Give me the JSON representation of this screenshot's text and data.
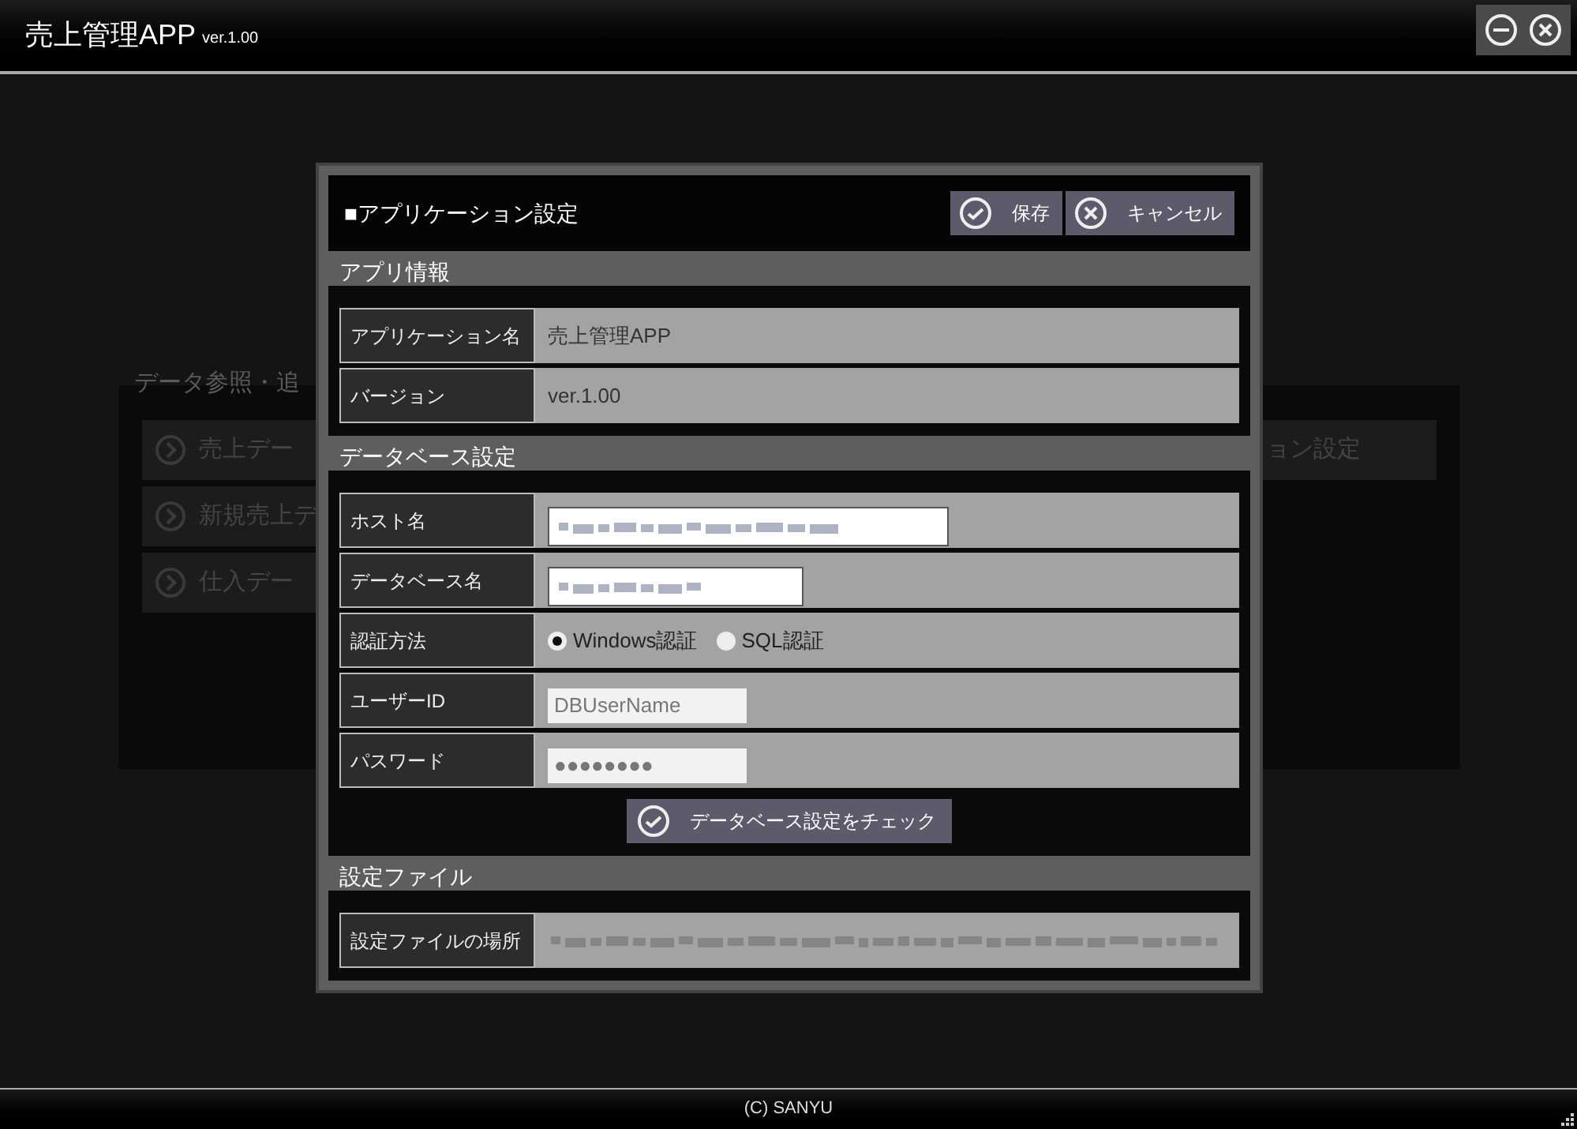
{
  "window": {
    "title": "売上管理APP",
    "version": "ver.1.00"
  },
  "background_menu": {
    "heading": "データ参照・追",
    "items": [
      {
        "label": "売上デー"
      },
      {
        "label": "新規売上デ"
      },
      {
        "label": "仕入デー"
      }
    ],
    "right_item": {
      "label": "ョン設定"
    }
  },
  "dialog": {
    "title": "■アプリケーション設定",
    "buttons": [
      {
        "label": "保存",
        "kind": "save"
      },
      {
        "label": "キャンセル",
        "kind": "cancel"
      }
    ],
    "sections": [
      {
        "title": "アプリ情報",
        "rows": [
          {
            "label": "アプリケーション名",
            "kind": "static",
            "value": "売上管理APP"
          },
          {
            "label": "バージョン",
            "kind": "static",
            "value": "ver.1.00"
          }
        ]
      },
      {
        "title": "データベース設定",
        "rows": [
          {
            "label": "ホスト名",
            "kind": "input",
            "redacted": true
          },
          {
            "label": "データベース名",
            "kind": "input",
            "redacted": true
          },
          {
            "label": "認証方法",
            "kind": "radio",
            "options": [
              {
                "label": "Windows認証",
                "selected": true
              },
              {
                "label": "SQL認証",
                "selected": false
              }
            ]
          },
          {
            "label": "ユーザーID",
            "kind": "input",
            "redacted": false,
            "value": "DBUserName"
          },
          {
            "label": "パスワード",
            "kind": "input",
            "redacted": false,
            "value": "●●●●●●●●"
          }
        ],
        "action": "データベース設定をチェック"
      },
      {
        "title": "設定ファイル",
        "rows": [
          {
            "label": "設定ファイルの場所",
            "kind": "static",
            "redacted": true
          }
        ]
      }
    ]
  },
  "footer": "(C) SANYU"
}
